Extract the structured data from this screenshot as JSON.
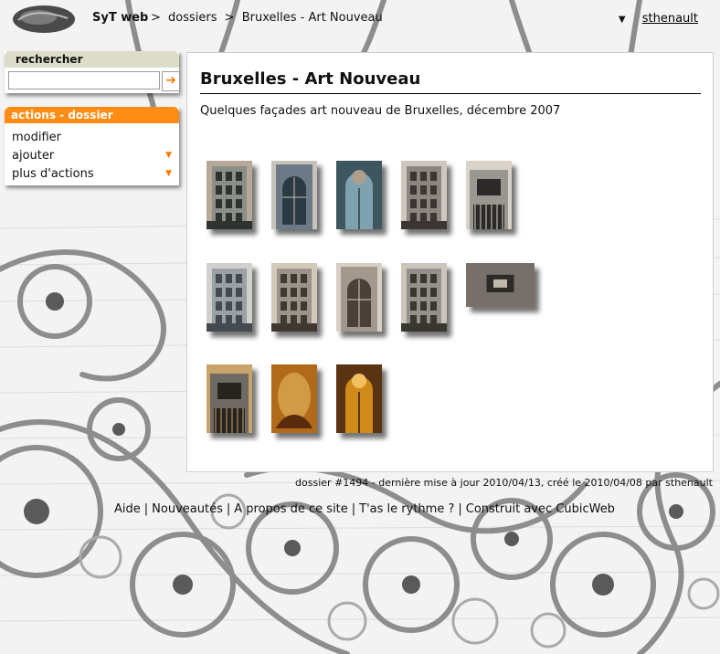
{
  "header": {
    "site_name": "SyT web",
    "breadcrumb": [
      ">",
      "dossiers",
      ">",
      "Bruxelles - Art Nouveau"
    ],
    "user_menu_icon": "triangle-down-icon",
    "username": "sthenault"
  },
  "search": {
    "title": "rechercher",
    "value": "",
    "submit_icon": "arrow-right-icon"
  },
  "actions": {
    "title": "actions - dossier",
    "items": [
      {
        "label": "modifier",
        "has_submenu": false
      },
      {
        "label": "ajouter",
        "has_submenu": true
      },
      {
        "label": "plus d'actions",
        "has_submenu": true
      }
    ]
  },
  "main": {
    "title": "Bruxelles - Art Nouveau",
    "description": "Quelques façades art nouveau de Bruxelles, décembre 2007",
    "thumbnails": [
      {
        "kind": "facade-tall",
        "palette": [
          "#8a8f8a",
          "#2f3330",
          "#b7a89a"
        ]
      },
      {
        "kind": "window-round",
        "palette": [
          "#6b7a86",
          "#2c3a44",
          "#c8c3b8"
        ]
      },
      {
        "kind": "door-round",
        "palette": [
          "#7fa2b0",
          "#3d5660",
          "#ad9f8e"
        ]
      },
      {
        "kind": "facade-building",
        "palette": [
          "#8c8580",
          "#3b3633",
          "#cfc7bd"
        ]
      },
      {
        "kind": "facade-gate",
        "palette": [
          "#9a9690",
          "#2b2a28",
          "#d8d2c8"
        ]
      },
      {
        "kind": "facade-building",
        "palette": [
          "#9ba0a5",
          "#444a50",
          "#d2d0cc"
        ]
      },
      {
        "kind": "facade-tall",
        "palette": [
          "#9c948a",
          "#40392f",
          "#d3c9bb"
        ]
      },
      {
        "kind": "window-round",
        "palette": [
          "#a3988e",
          "#4b4038",
          "#d7cfc4"
        ]
      },
      {
        "kind": "facade-building",
        "palette": [
          "#95908b",
          "#3a3632",
          "#ccc5bb"
        ]
      },
      {
        "kind": "facade-wide",
        "palette": [
          "#77706a",
          "#2e2a27",
          "#c2b9ad"
        ]
      },
      {
        "kind": "facade-gate",
        "palette": [
          "#6f6a66",
          "#27231f",
          "#c9a46a"
        ]
      },
      {
        "kind": "painting",
        "palette": [
          "#b06a1a",
          "#5a2a0c",
          "#e0b05a"
        ]
      },
      {
        "kind": "door-round",
        "palette": [
          "#d08a1a",
          "#5a3412",
          "#f2c060"
        ]
      }
    ]
  },
  "footer": {
    "info": "dossier #1494 - dernière mise à jour 2010/04/13, créé le 2010/04/08 par sthenault",
    "links": [
      "Aide",
      "Nouveautés",
      "A propos de ce site",
      "T'as le rythme ?",
      "Construit avec CubicWeb"
    ],
    "separator": "|"
  },
  "colors": {
    "accent": "#ff8c14",
    "search_header": "#dcdcc8",
    "content_bg": "#ffffff"
  }
}
